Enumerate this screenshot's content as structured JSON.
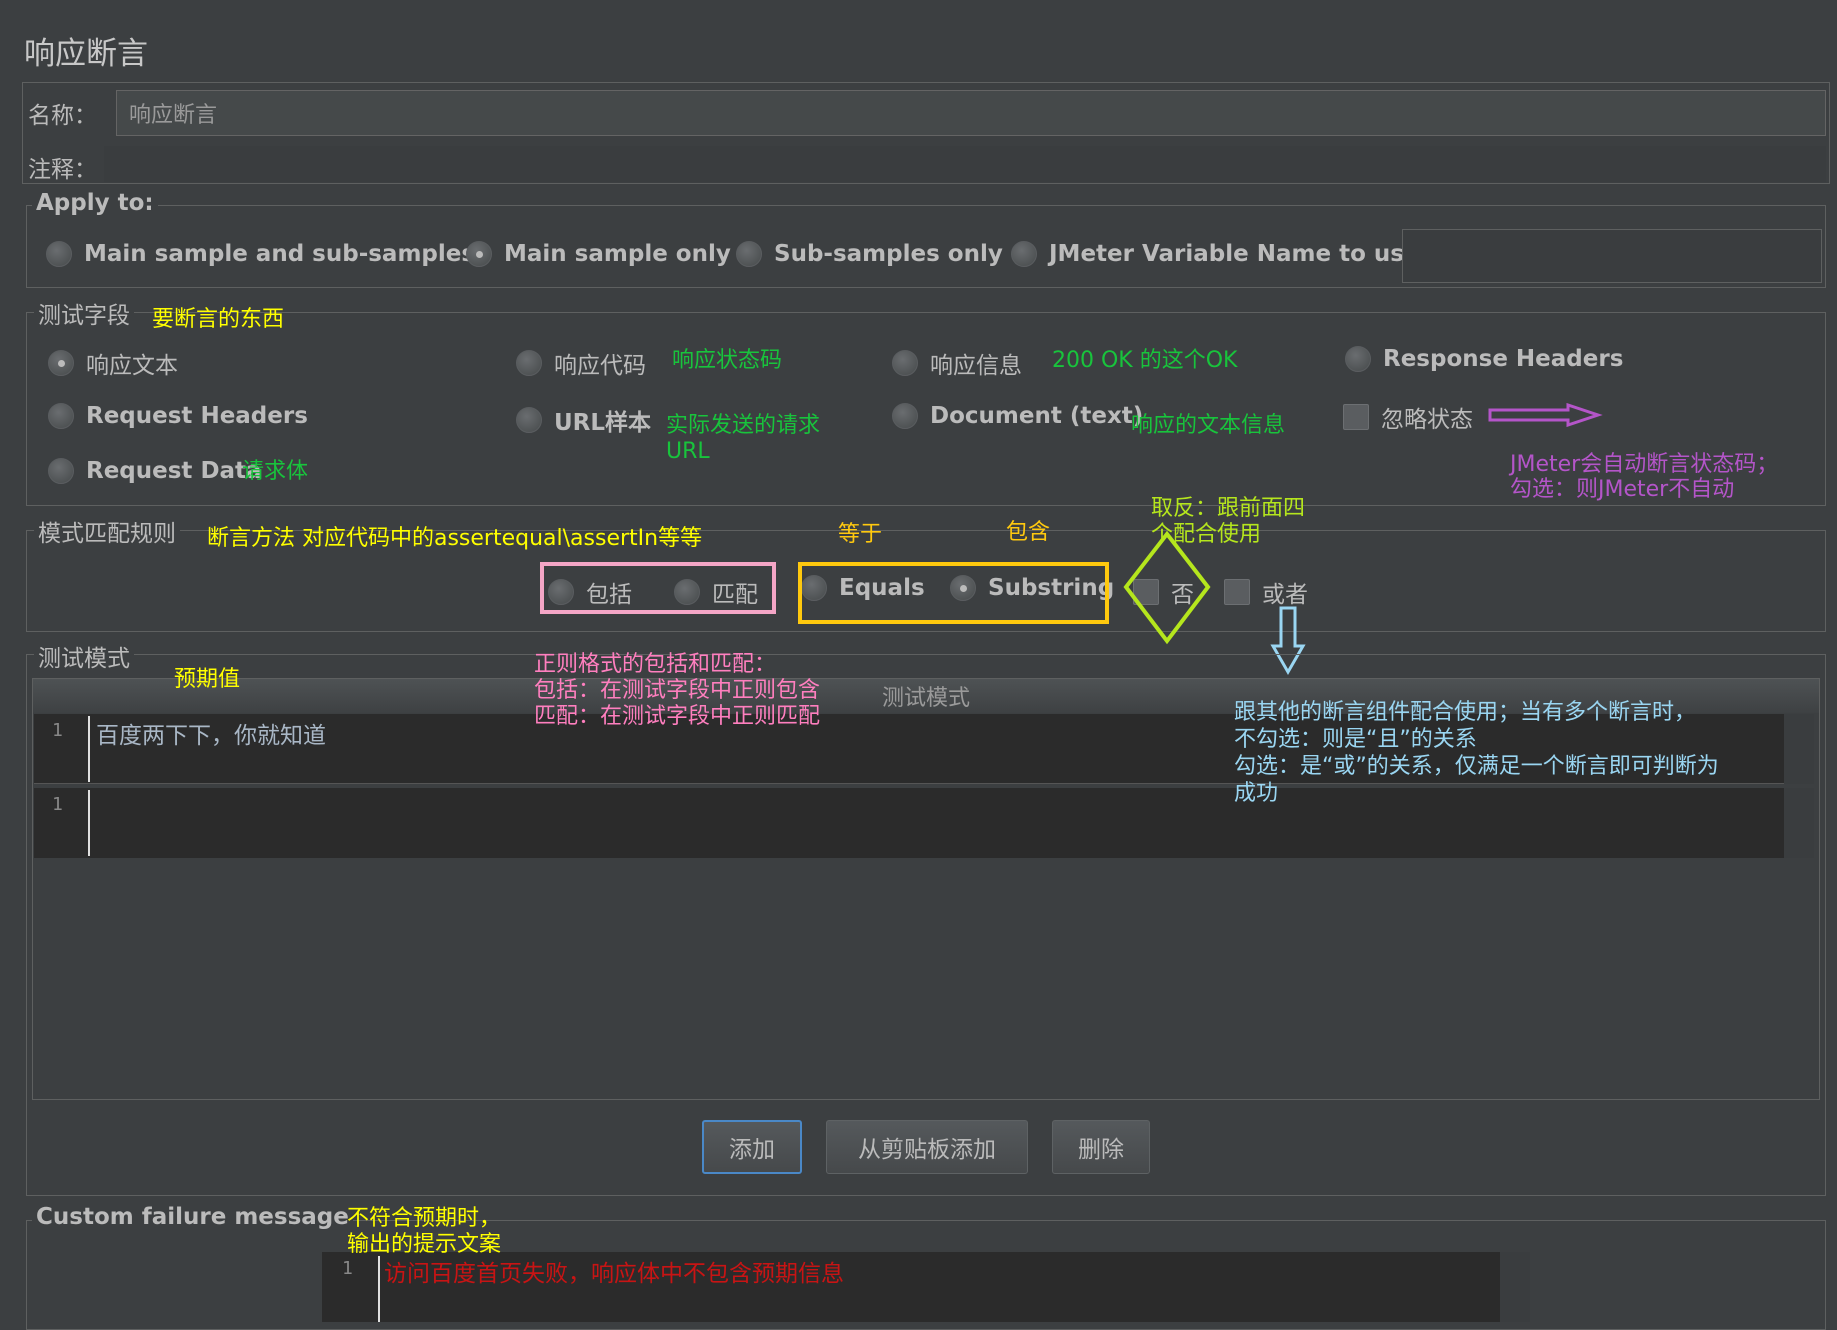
{
  "panel_title": "响应断言",
  "name": {
    "label": "名称：",
    "value": "响应断言"
  },
  "comment": {
    "label": "注释：",
    "value": ""
  },
  "apply_to": {
    "legend": "Apply to:",
    "options": [
      "Main sample and sub-samples",
      "Main sample only",
      "Sub-samples only",
      "JMeter Variable Name to use"
    ],
    "selected": "Main sample only",
    "variable_value": ""
  },
  "test_field": {
    "legend": "测试字段",
    "options": [
      "响应文本",
      "响应代码",
      "响应信息",
      "Response Headers",
      "Request Headers",
      "URL样本",
      "Document (text)",
      "Request Data"
    ],
    "selected": "响应文本",
    "ignore_status_label": "忽略状态"
  },
  "pattern_rules": {
    "legend": "模式匹配规则",
    "options": [
      "包括",
      "匹配",
      "Equals",
      "Substring"
    ],
    "selected": "Substring",
    "not_label": "否",
    "or_label": "或者"
  },
  "test_patterns": {
    "legend": "测试模式",
    "column_header": "测试模式",
    "rows": [
      {
        "line": "1",
        "text": "百度两下下，你就知道"
      },
      {
        "line": "1",
        "text": ""
      }
    ]
  },
  "buttons": {
    "add": "添加",
    "add_clipboard": "从剪贴板添加",
    "delete": "删除"
  },
  "failure_message": {
    "legend": "Custom failure message",
    "line": "1",
    "text": "访问百度首页失败，响应体中不包含预期信息"
  },
  "annotations": {
    "what_to_assert": "要断言的东西",
    "response_code": "响应状态码",
    "response_message": "200 OK 的这个OK",
    "url_sample": [
      "实际发送的请求",
      "URL"
    ],
    "document_text": "响应的文本信息",
    "request_data": "请求体",
    "ignore_status": [
      "JMeter会自动断言状态码；",
      "勾选：则JMeter不自动"
    ],
    "assert_method": "断言方法 对应代码中的assertequal\\assertIn等等",
    "equals": "等于",
    "substring": "包含",
    "negate": [
      "取反：跟前面四",
      "个配合使用"
    ],
    "regex": [
      "正则格式的包括和匹配：",
      "包括：在测试字段中正则包含",
      "匹配：在测试字段中正则匹配"
    ],
    "or_usage": [
      "跟其他的断言组件配合使用；当有多个断言时，",
      "不勾选：则是“且”的关系",
      "勾选：是“或”的关系，仅满足一个断言即可判断为",
      "成功"
    ],
    "expected": "预期值",
    "failure": [
      "不符合预期时，",
      "输出的提示文案"
    ]
  },
  "colors": {
    "background": "#3c3f41",
    "editor": "#2b2b2b",
    "yellow": "#ffff00",
    "green": "#18c43c",
    "purple": "#b455c9",
    "cyan": "#9ad6f2",
    "lime": "#b5e61d",
    "pink": "#ff7fbf",
    "orange": "#ffc90e",
    "red": "#c81414"
  }
}
